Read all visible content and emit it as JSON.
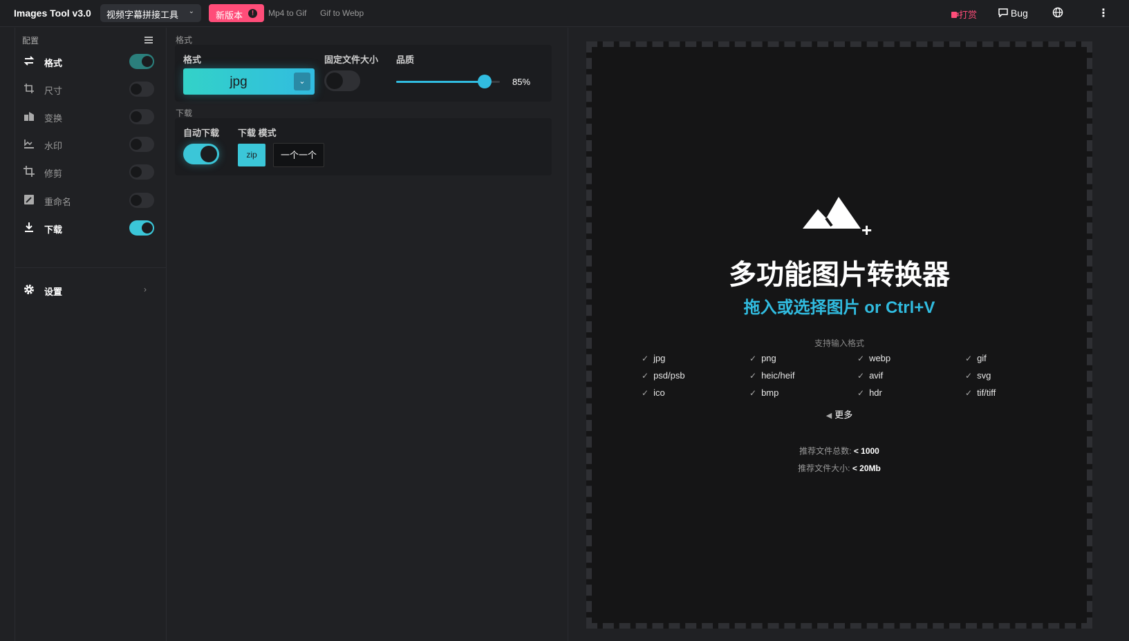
{
  "header": {
    "app_title": "Images Tool v3.0",
    "tool_select": "视频字幕拼接工具",
    "new_version": "新版本",
    "links": [
      "Mp4 to Gif",
      "Gif to Webp"
    ],
    "donate": "打赏",
    "bug": "Bug"
  },
  "sidebar": {
    "title": "配置",
    "items": [
      {
        "label": "格式",
        "icon": "swap-icon",
        "on": true
      },
      {
        "label": "尺寸",
        "icon": "resize-icon",
        "on": false
      },
      {
        "label": "变换",
        "icon": "transform-icon",
        "on": false
      },
      {
        "label": "水印",
        "icon": "watermark-icon",
        "on": false
      },
      {
        "label": "修剪",
        "icon": "crop-icon",
        "on": false
      },
      {
        "label": "重命名",
        "icon": "rename-icon",
        "on": false
      },
      {
        "label": "下载",
        "icon": "download-icon",
        "on": true
      }
    ],
    "settings": "设置"
  },
  "format_section": {
    "title": "格式",
    "format_label": "格式",
    "format_value": "jpg",
    "fixed_size_label": "固定文件大小",
    "fixed_size_on": false,
    "quality_label": "品质",
    "quality_value": "85%",
    "quality_fraction": 0.85
  },
  "download_section": {
    "title": "下载",
    "auto_label": "自动下载",
    "auto_on": true,
    "mode_label": "下载 模式",
    "mode_zip": "zip",
    "mode_one": "一个一个"
  },
  "dropzone": {
    "title": "多功能图片转换器",
    "subtitle": "拖入或选择图片 or Ctrl+V",
    "support_label": "支持输入格式",
    "formats": [
      "jpg",
      "png",
      "webp",
      "gif",
      "psd/psb",
      "heic/heif",
      "avif",
      "svg",
      "ico",
      "bmp",
      "hdr",
      "tif/tiff"
    ],
    "more": "更多",
    "rec_count_label": "推荐文件总数:",
    "rec_count_value": "< 1000",
    "rec_size_label": "推荐文件大小:",
    "rec_size_value": "< 20Mb"
  },
  "colors": {
    "accent": "#31bce0",
    "accent_teal": "#33d2c8",
    "new_badge": "#ff4d79",
    "background": "#202124"
  }
}
